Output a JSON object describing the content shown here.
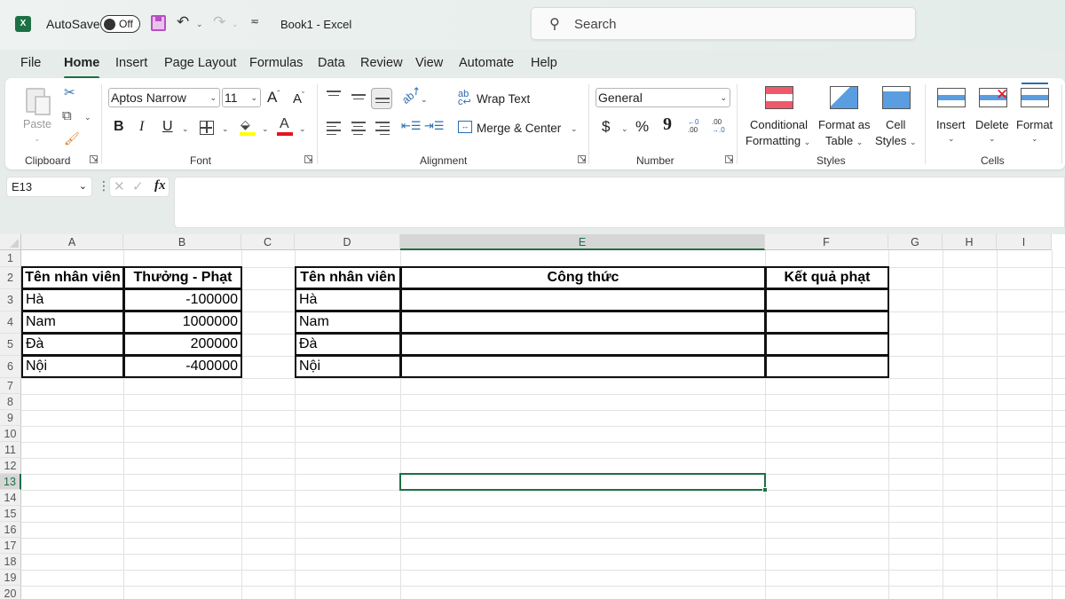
{
  "titlebar": {
    "app_icon_letter": "X",
    "autosave_label": "AutoSave",
    "autosave_state": "Off",
    "document_title": "Book1  -  Excel",
    "search_placeholder": "Search"
  },
  "menu": {
    "tabs": [
      "File",
      "Home",
      "Insert",
      "Page Layout",
      "Formulas",
      "Data",
      "Review",
      "View",
      "Automate",
      "Help"
    ],
    "active_tab": "Home"
  },
  "ribbon": {
    "clipboard": {
      "label": "Clipboard",
      "paste": "Paste"
    },
    "font": {
      "label": "Font",
      "font_name": "Aptos Narrow",
      "font_size": "11",
      "bold": "B",
      "italic": "I",
      "underline": "U",
      "grow": "A",
      "shrink": "A",
      "font_color_letter": "A",
      "fill_color": "#ffff00",
      "font_color": "#e81123"
    },
    "alignment": {
      "label": "Alignment",
      "wrap_text": "Wrap Text",
      "merge_center": "Merge & Center"
    },
    "number": {
      "label": "Number",
      "format": "General",
      "currency": "$",
      "percent": "%",
      "comma": "9",
      "inc_decimal_top": "←0",
      "inc_decimal_bottom": ".00",
      "dec_decimal_top": ".00",
      "dec_decimal_bottom": "→.0"
    },
    "styles": {
      "label": "Styles",
      "conditional_1": "Conditional",
      "conditional_2": "Formatting",
      "format_table_1": "Format as",
      "format_table_2": "Table",
      "cell_styles_1": "Cell",
      "cell_styles_2": "Styles"
    },
    "cells": {
      "label": "Cells",
      "insert": "Insert",
      "delete": "Delete",
      "format": "Format"
    }
  },
  "formula_bar": {
    "name_box": "E13",
    "fx": "fx",
    "cancel": "✕",
    "enter": "✓",
    "formula": ""
  },
  "sheet": {
    "columns": [
      "A",
      "B",
      "C",
      "D",
      "E",
      "F",
      "G",
      "H",
      "I"
    ],
    "selected_column": "E",
    "rows": [
      "1",
      "2",
      "3",
      "4",
      "5",
      "6",
      "7",
      "8",
      "9",
      "10",
      "11",
      "12",
      "13",
      "14",
      "15",
      "16",
      "17",
      "18",
      "19",
      "20"
    ],
    "selected_row": "13",
    "active_cell": "E13",
    "table1": {
      "headers": [
        "Tên nhân viên",
        "Thưởng - Phạt"
      ],
      "rows": [
        [
          "Hà",
          "-100000"
        ],
        [
          "Nam",
          "1000000"
        ],
        [
          "Đà",
          "200000"
        ],
        [
          "Nội",
          "-400000"
        ]
      ]
    },
    "table2": {
      "headers": [
        "Tên nhân viên",
        "Công thức",
        "Kết quả phạt"
      ],
      "rows": [
        [
          "Hà",
          "",
          ""
        ],
        [
          "Nam",
          "",
          ""
        ],
        [
          "Đà",
          "",
          ""
        ],
        [
          "Nội",
          "",
          ""
        ]
      ]
    }
  },
  "colors": {
    "accent": "#1d7044",
    "ribbon_bg": "#ffffff",
    "chrome_bg": "#e6ecea"
  }
}
